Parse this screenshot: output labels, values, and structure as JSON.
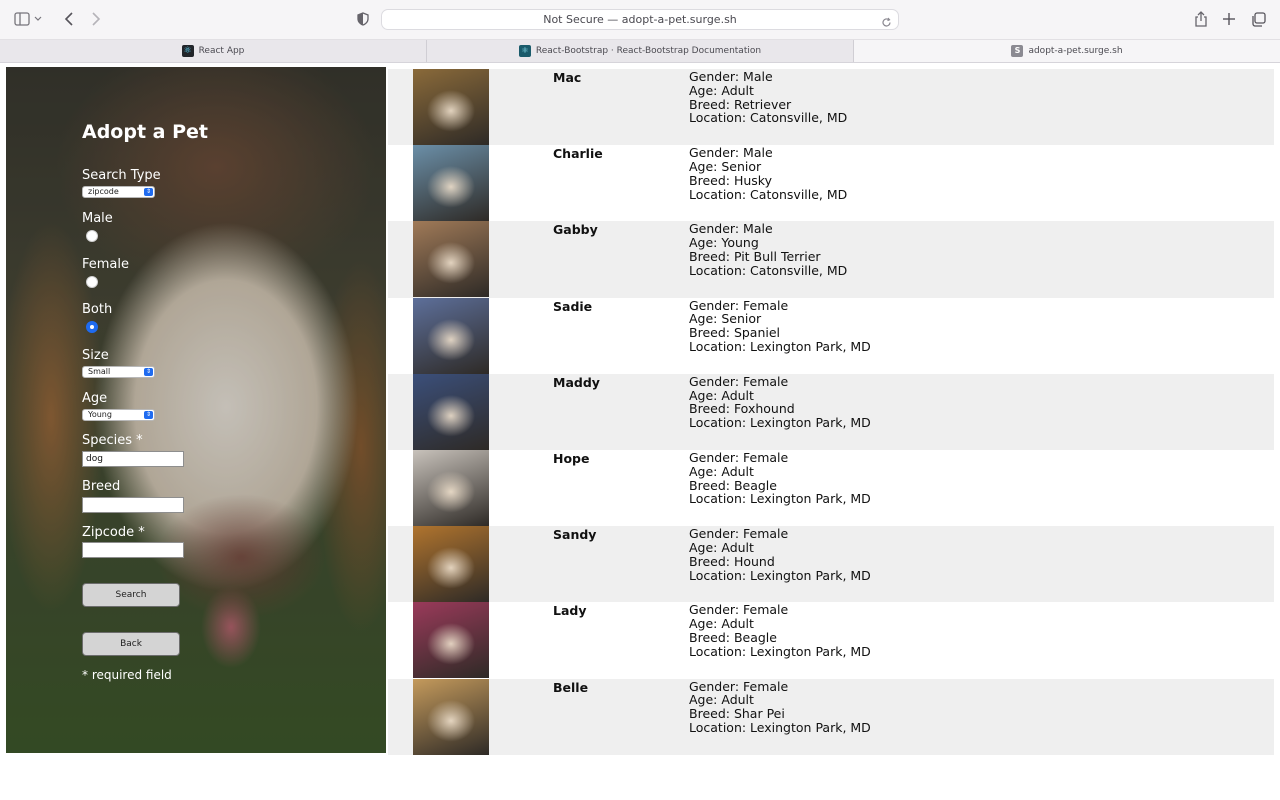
{
  "browser": {
    "address": "Not Secure — adopt-a-pet.surge.sh",
    "tabs": [
      {
        "label": "React App"
      },
      {
        "label": "React-Bootstrap · React-Bootstrap Documentation"
      },
      {
        "label": "adopt-a-pet.surge.sh"
      }
    ]
  },
  "form": {
    "title": "Adopt a Pet",
    "search_type_label": "Search Type",
    "search_type_value": "zipcode",
    "male_label": "Male",
    "female_label": "Female",
    "both_label": "Both",
    "selected_gender": "Both",
    "size_label": "Size",
    "size_value": "Small",
    "age_label": "Age",
    "age_value": "Young",
    "species_label": "Species *",
    "species_value": "dog",
    "breed_label": "Breed",
    "breed_value": "",
    "zipcode_label": "Zipcode *",
    "zipcode_value": "",
    "search_button": "Search",
    "back_button": "Back",
    "required_note": "* required field"
  },
  "pets": [
    {
      "name": "Mac",
      "gender": "Gender: Male",
      "age": "Age: Adult",
      "breed": "Breed: Retriever",
      "location": "Location: Catonsville, MD",
      "photo": "#8a6a3a"
    },
    {
      "name": "Charlie",
      "gender": "Gender: Male",
      "age": "Age: Senior",
      "breed": "Breed: Husky",
      "location": "Location: Catonsville, MD",
      "photo": "#6b8fa8"
    },
    {
      "name": "Gabby",
      "gender": "Gender: Male",
      "age": "Age: Young",
      "breed": "Breed: Pit Bull Terrier",
      "location": "Location: Catonsville, MD",
      "photo": "#a07a58"
    },
    {
      "name": "Sadie",
      "gender": "Gender: Female",
      "age": "Age: Senior",
      "breed": "Breed: Spaniel",
      "location": "Location: Lexington Park, MD",
      "photo": "#5d6f9a"
    },
    {
      "name": "Maddy",
      "gender": "Gender: Female",
      "age": "Age: Adult",
      "breed": "Breed: Foxhound",
      "location": "Location: Lexington Park, MD",
      "photo": "#3b4f7a"
    },
    {
      "name": "Hope",
      "gender": "Gender: Female",
      "age": "Age: Adult",
      "breed": "Breed: Beagle",
      "location": "Location: Lexington Park, MD",
      "photo": "#c8c2bb"
    },
    {
      "name": "Sandy",
      "gender": "Gender: Female",
      "age": "Age: Adult",
      "breed": "Breed: Hound",
      "location": "Location: Lexington Park, MD",
      "photo": "#b0742e"
    },
    {
      "name": "Lady",
      "gender": "Gender: Female",
      "age": "Age: Adult",
      "breed": "Breed: Beagle",
      "location": "Location: Lexington Park, MD",
      "photo": "#9a3a5a"
    },
    {
      "name": "Belle",
      "gender": "Gender: Female",
      "age": "Age: Adult",
      "breed": "Breed: Shar Pei",
      "location": "Location: Lexington Park, MD",
      "photo": "#c49a5c"
    }
  ]
}
